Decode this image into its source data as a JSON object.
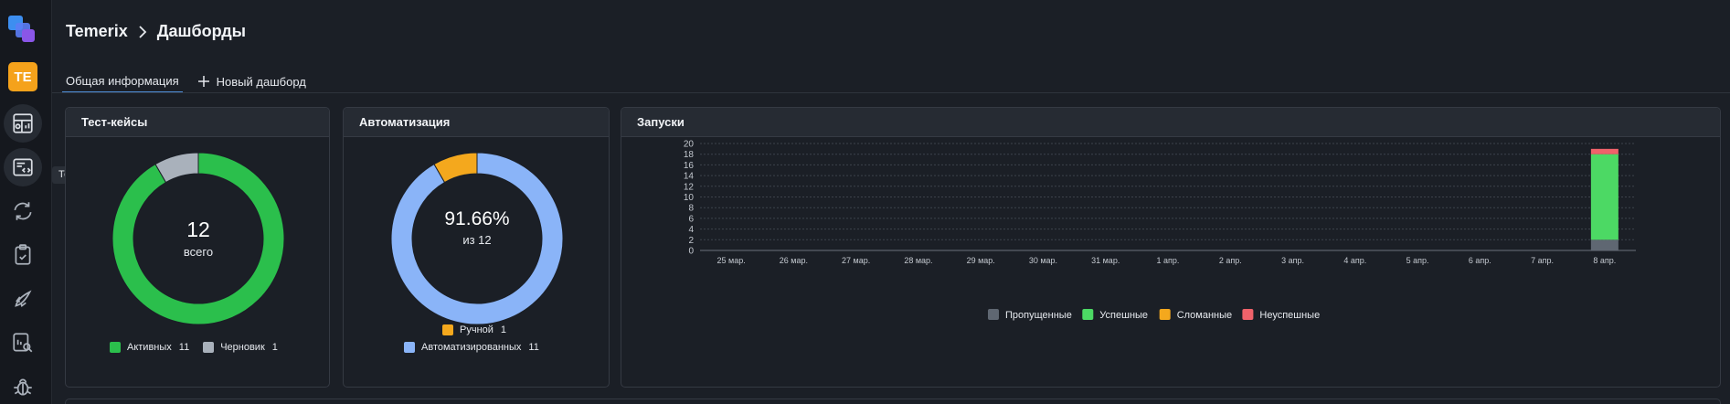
{
  "app": {
    "name": "Temerix",
    "page": "Дашборды"
  },
  "sidebar": {
    "avatar": "TE",
    "items": [
      {
        "name": "dashboard-icon"
      },
      {
        "name": "test-cases-icon",
        "tooltip": "Тест-кейсы"
      },
      {
        "name": "sync-icon"
      },
      {
        "name": "clipboard-check-icon"
      },
      {
        "name": "rocket-icon"
      },
      {
        "name": "report-search-icon"
      },
      {
        "name": "bug-icon"
      }
    ]
  },
  "tabs": {
    "active": "Общая информация",
    "new": "Новый дашборд"
  },
  "test_cases": {
    "title": "Тест-кейсы",
    "total": "12",
    "total_label": "всего",
    "legend": [
      {
        "label": "Активных",
        "value": "11",
        "color": "#2bbf4c"
      },
      {
        "label": "Черновик",
        "value": "1",
        "color": "#a9b1bb"
      }
    ]
  },
  "automation": {
    "title": "Автоматизация",
    "percent": "91.66%",
    "of_label": "из 12",
    "legend": [
      {
        "label": "Ручной",
        "value": "1",
        "color": "#f4a81d"
      },
      {
        "label": "Автоматизированных",
        "value": "11",
        "color": "#8ab4f8"
      }
    ]
  },
  "launches": {
    "title": "Запуски"
  },
  "chart_data": [
    {
      "type": "pie",
      "title": "Тест-кейсы",
      "categories": [
        "Активных",
        "Черновик"
      ],
      "values": [
        11,
        1
      ],
      "colors": [
        "#2bbf4c",
        "#a9b1bb"
      ]
    },
    {
      "type": "pie",
      "title": "Автоматизация",
      "categories": [
        "Ручной",
        "Автоматизированных"
      ],
      "values": [
        1,
        11
      ],
      "colors": [
        "#f4a81d",
        "#8ab4f8"
      ]
    },
    {
      "type": "bar",
      "title": "Запуски",
      "stacked": true,
      "categories": [
        "25 мар.",
        "26 мар.",
        "27 мар.",
        "28 мар.",
        "29 мар.",
        "30 мар.",
        "31 мар.",
        "1 апр.",
        "2 апр.",
        "3 апр.",
        "4 апр.",
        "5 апр.",
        "6 апр.",
        "7 апр.",
        "8 апр."
      ],
      "series": [
        {
          "name": "Пропущенные",
          "color": "#5f6772",
          "values": [
            0,
            0,
            0,
            0,
            0,
            0,
            0,
            0,
            0,
            0,
            0,
            0,
            0,
            0,
            2
          ]
        },
        {
          "name": "Успешные",
          "color": "#4cd964",
          "values": [
            0,
            0,
            0,
            0,
            0,
            0,
            0,
            0,
            0,
            0,
            0,
            0,
            0,
            0,
            16
          ]
        },
        {
          "name": "Сломанные",
          "color": "#f4a81d",
          "values": [
            0,
            0,
            0,
            0,
            0,
            0,
            0,
            0,
            0,
            0,
            0,
            0,
            0,
            0,
            0
          ]
        },
        {
          "name": "Неуспешные",
          "color": "#f0626a",
          "values": [
            0,
            0,
            0,
            0,
            0,
            0,
            0,
            0,
            0,
            0,
            0,
            0,
            0,
            0,
            1
          ]
        }
      ],
      "yticks": [
        0,
        2,
        4,
        6,
        8,
        10,
        12,
        14,
        16,
        18,
        20
      ],
      "ylim": [
        0,
        20
      ],
      "grid": true,
      "legend_position": "bottom"
    }
  ]
}
